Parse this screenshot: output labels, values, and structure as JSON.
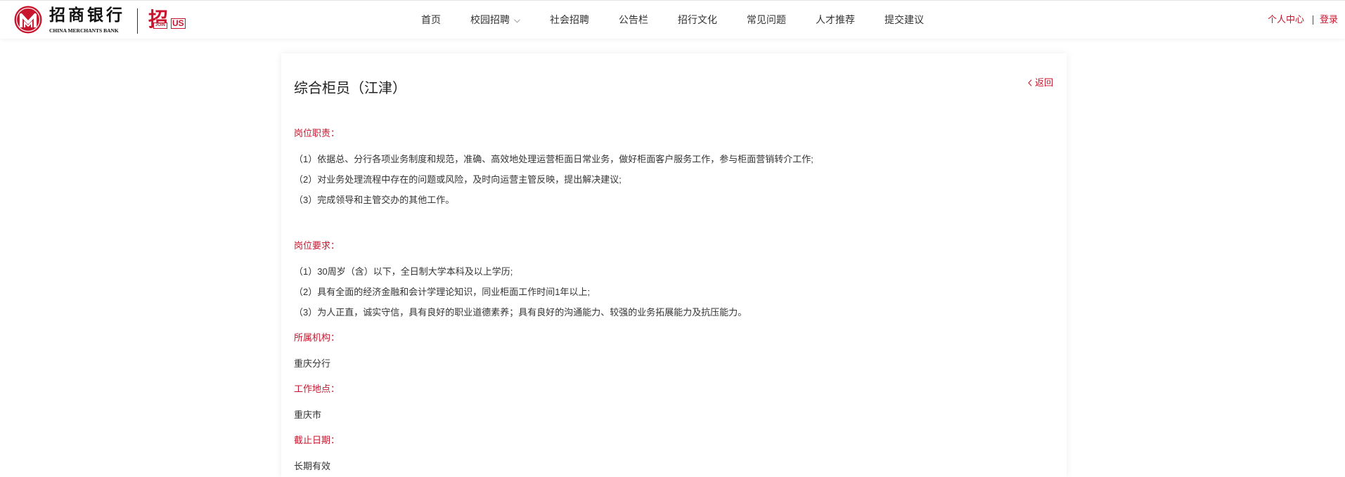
{
  "colors": {
    "brand_red": "#c8152d",
    "text": "#333333"
  },
  "header": {
    "logo": {
      "icon": "cmb-logo-icon",
      "cn_name": "招商银行",
      "en_name": "CHINA MERCHANTS BANK",
      "join_char": "招",
      "join_word_1": "JOIN",
      "join_word_2": "US"
    },
    "nav": [
      {
        "label": "首页"
      },
      {
        "label": "校园招聘",
        "icon": "chevron-down-icon"
      },
      {
        "label": "社会招聘"
      },
      {
        "label": "公告栏"
      },
      {
        "label": "招行文化"
      },
      {
        "label": "常见问题"
      },
      {
        "label": "人才推荐"
      },
      {
        "label": "提交建议"
      }
    ],
    "user_links": {
      "profile": "个人中心",
      "login": "登录"
    }
  },
  "job": {
    "title": "综合柜员（江津）",
    "back": {
      "label": "返回",
      "icon": "chevron-left-icon"
    },
    "responsibilities": {
      "label": "岗位职责：",
      "items": [
        "（1）依据总、分行各项业务制度和规范，准确、高效地处理运营柜面日常业务，做好柜面客户服务工作，参与柜面营销转介工作;",
        "（2）对业务处理流程中存在的问题或风险，及时向运营主管反映，提出解决建议;",
        "（3）完成领导和主管交办的其他工作。"
      ]
    },
    "requirements": {
      "label": "岗位要求：",
      "items": [
        "（1）30周岁（含）以下，全日制大学本科及以上学历;",
        "（2）具有全面的经济金融和会计学理论知识，同业柜面工作时间1年以上;",
        "（3）为人正直，诚实守信，具有良好的职业道德素养；具有良好的沟通能力、较强的业务拓展能力及抗压能力。"
      ]
    },
    "organization": {
      "label": "所属机构：",
      "value": "重庆分行"
    },
    "location": {
      "label": "工作地点：",
      "value": "重庆市"
    },
    "deadline": {
      "label": "截止日期：",
      "value": "长期有效"
    }
  }
}
